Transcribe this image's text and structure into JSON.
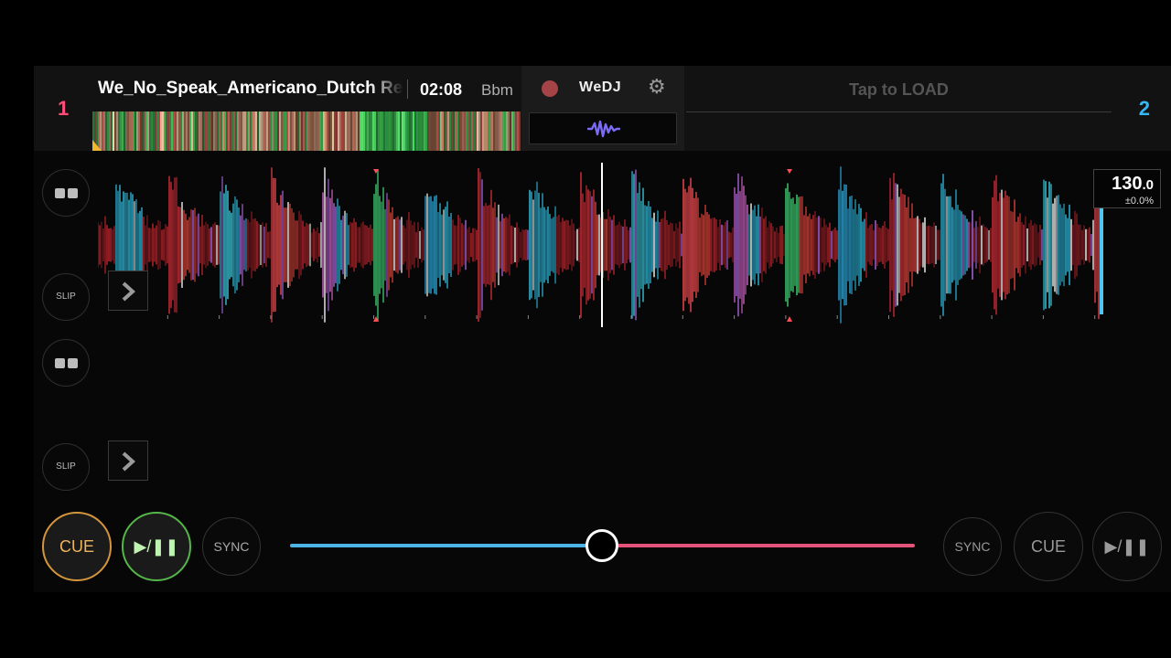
{
  "deck1": {
    "number": "1",
    "track_title": "We_No_Speak_Americano_Dutch Red",
    "time": "02:08",
    "key": "Bbm",
    "bpm": {
      "integer": "130",
      "decimal": ".0",
      "pitch": "±0.0%"
    },
    "cue_label": "CUE",
    "play_label": "▶/❚❚",
    "sync_label": "SYNC",
    "slip_label": "SLIP"
  },
  "deck2": {
    "number": "2",
    "load_prompt": "Tap to LOAD",
    "cue_label": "CUE",
    "play_label": "▶/❚❚",
    "sync_label": "SYNC",
    "slip_label": "SLIP"
  },
  "center": {
    "brand": "WeDJ",
    "record_icon": "record-icon",
    "settings_icon": "gear-icon",
    "waveform_icon": "waveform-icon"
  },
  "crossfader": {
    "position": 0.5
  },
  "colors": {
    "deck1_accent": "#ff4f78",
    "deck2_accent": "#35b7f4",
    "cue_active": "#d4963c",
    "play_active": "#55b64a",
    "crossfader_left": "#4bb3e5",
    "crossfader_right": "#e4537a"
  }
}
